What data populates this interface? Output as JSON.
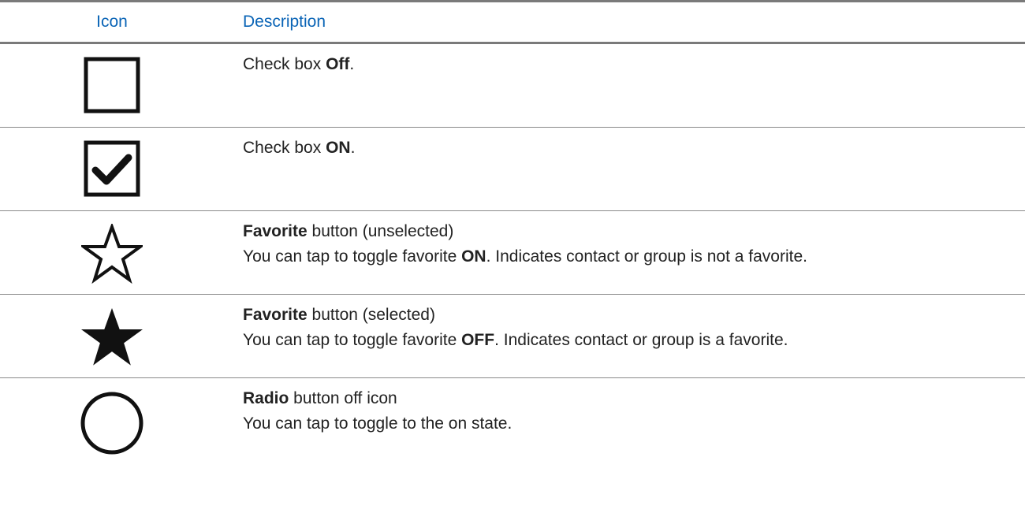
{
  "table": {
    "header": {
      "icon": "Icon",
      "description": "Description"
    },
    "rows": [
      {
        "icon": "checkbox-off-icon",
        "lines": [
          [
            {
              "text": "Check box ",
              "bold": false
            },
            {
              "text": "Off",
              "bold": true
            },
            {
              "text": ".",
              "bold": false
            }
          ]
        ]
      },
      {
        "icon": "checkbox-on-icon",
        "lines": [
          [
            {
              "text": "Check box ",
              "bold": false
            },
            {
              "text": "ON",
              "bold": true
            },
            {
              "text": ".",
              "bold": false
            }
          ]
        ]
      },
      {
        "icon": "star-outline-icon",
        "lines": [
          [
            {
              "text": "Favorite",
              "bold": true
            },
            {
              "text": " button (unselected)",
              "bold": false
            }
          ],
          [
            {
              "text": "You can tap to toggle favorite ",
              "bold": false
            },
            {
              "text": "ON",
              "bold": true
            },
            {
              "text": ". Indicates contact or group is not a favorite.",
              "bold": false
            }
          ]
        ]
      },
      {
        "icon": "star-filled-icon",
        "lines": [
          [
            {
              "text": "Favorite",
              "bold": true
            },
            {
              "text": " button (selected)",
              "bold": false
            }
          ],
          [
            {
              "text": "You can tap to toggle favorite ",
              "bold": false
            },
            {
              "text": "OFF",
              "bold": true
            },
            {
              "text": ". Indicates contact or group is a favorite.",
              "bold": false
            }
          ]
        ]
      },
      {
        "icon": "radio-off-icon",
        "lines": [
          [
            {
              "text": "Radio",
              "bold": true
            },
            {
              "text": " button off icon",
              "bold": false
            }
          ],
          [
            {
              "text": "You can tap to toggle to the on state.",
              "bold": false
            }
          ]
        ]
      }
    ]
  },
  "colors": {
    "header_text": "#0a64b6",
    "rule": "#7a7a7a"
  }
}
